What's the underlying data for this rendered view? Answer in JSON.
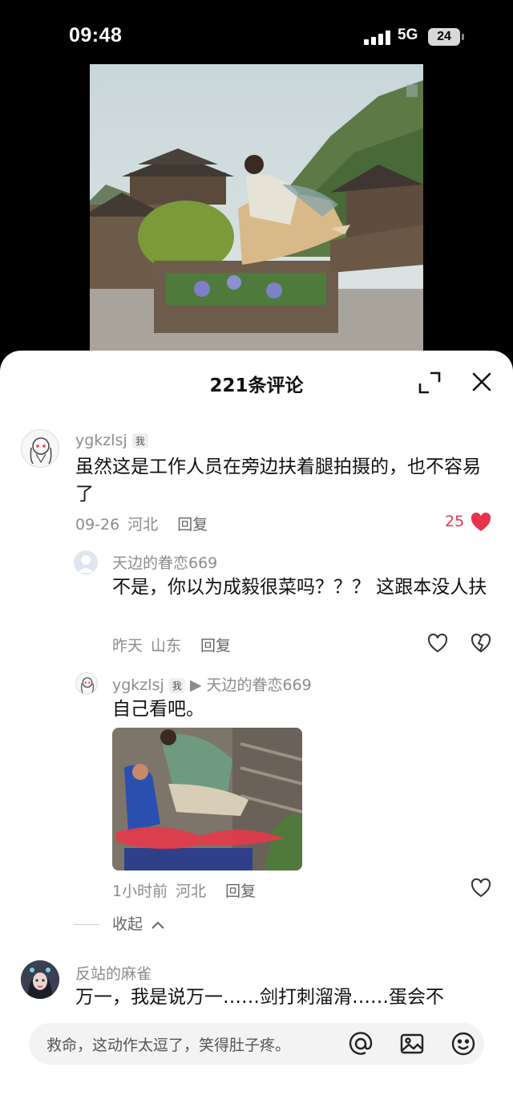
{
  "status_bar": {
    "time": "09:48",
    "network": "5G",
    "battery": "24"
  },
  "sheet": {
    "title": "221条评论"
  },
  "comments": [
    {
      "user": "ygkzlsj",
      "tag": "我",
      "text": "虽然这是工作人员在旁边扶着腿拍摄的，也不容易了",
      "date": "09-26",
      "location": "河北",
      "reply_label": "回复",
      "likes": "25"
    },
    {
      "user": "天边的眷恋669",
      "text": "不是，你以为成毅很菜吗？？？ 这跟本没人扶",
      "date": "昨天",
      "location": "山东",
      "reply_label": "回复"
    },
    {
      "user": "ygkzlsj",
      "tag": "我",
      "reply_to": "▶ 天边的眷恋669",
      "text": "自己看吧。",
      "date": "1小时前",
      "location": "河北",
      "reply_label": "回复"
    },
    {
      "user": "反站的麻雀",
      "text": "万一，我是说万一……剑打刺溜滑……蛋会不"
    }
  ],
  "collapse_label": "收起",
  "input": {
    "placeholder": "救命，这动作太逗了，笑得肚子疼。"
  },
  "colors": {
    "like": "#e8334a",
    "meta": "#8c8c8c"
  },
  "icons": [
    "expand-icon",
    "close-icon",
    "heart-filled-icon",
    "heart-outline-icon",
    "heart-broken-icon",
    "at-icon",
    "image-icon",
    "emoji-icon"
  ]
}
